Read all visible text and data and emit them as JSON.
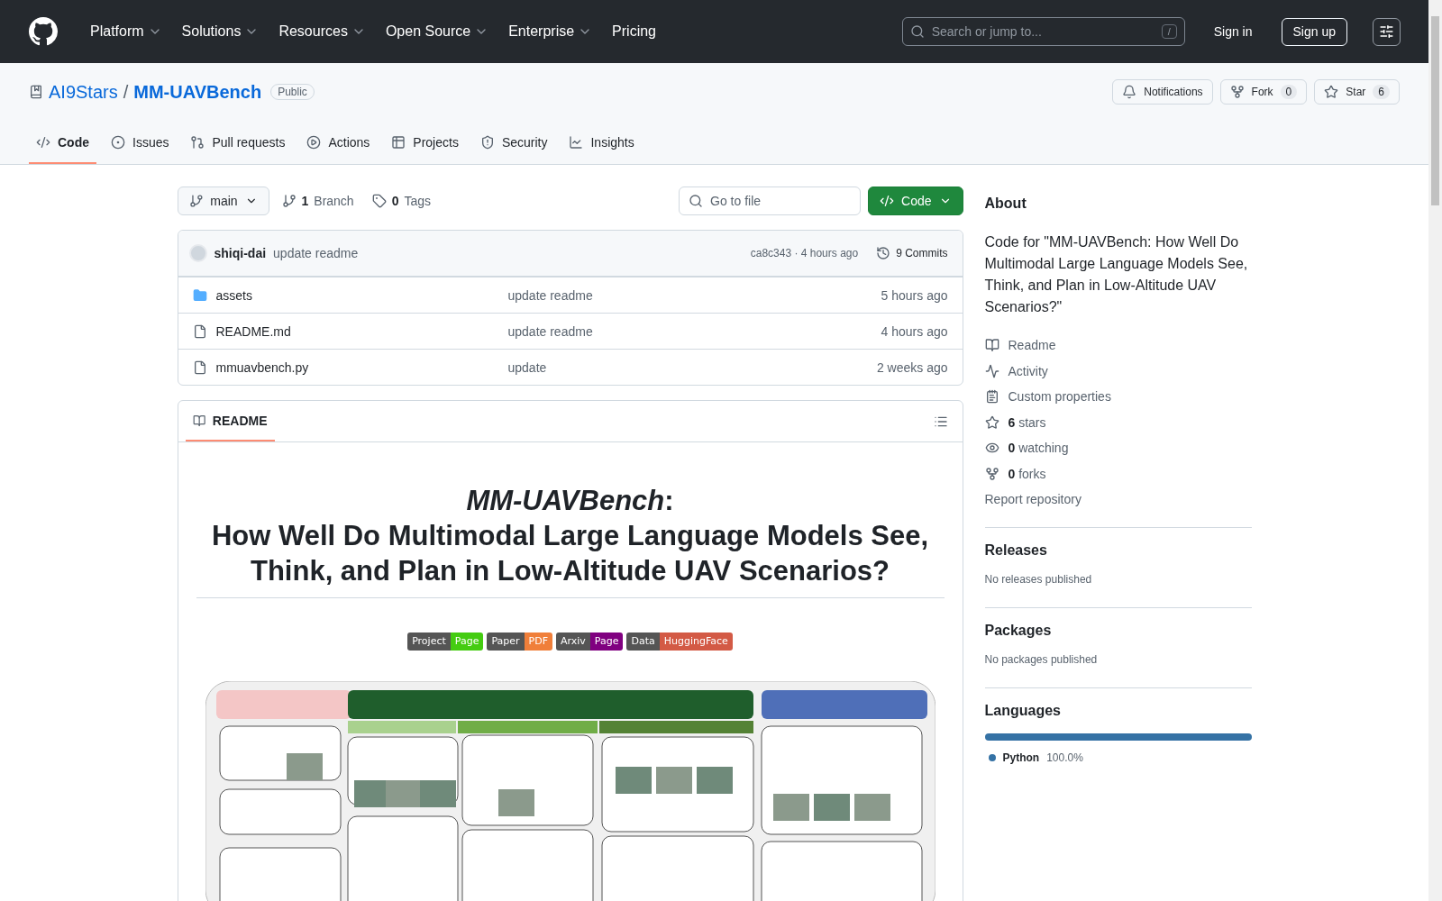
{
  "header": {
    "nav": [
      {
        "label": "Platform",
        "dropdown": true
      },
      {
        "label": "Solutions",
        "dropdown": true
      },
      {
        "label": "Resources",
        "dropdown": true
      },
      {
        "label": "Open Source",
        "dropdown": true
      },
      {
        "label": "Enterprise",
        "dropdown": true
      },
      {
        "label": "Pricing",
        "dropdown": false
      }
    ],
    "search": {
      "placeholder": "Search or jump to...",
      "shortcut": "/"
    },
    "sign_in": "Sign in",
    "sign_up": "Sign up"
  },
  "repo": {
    "owner": "AI9Stars",
    "separator": "/",
    "name": "MM-UAVBench",
    "visibility": "Public",
    "actions": [
      {
        "kind": "notifications",
        "label": "Notifications"
      },
      {
        "kind": "fork",
        "label": "Fork",
        "count": "0"
      },
      {
        "kind": "star",
        "label": "Star",
        "count": "6"
      }
    ],
    "tabs": [
      {
        "kind": "code",
        "label": "Code",
        "selected": true
      },
      {
        "kind": "issues",
        "label": "Issues",
        "selected": false
      },
      {
        "kind": "pulls",
        "label": "Pull requests",
        "selected": false
      },
      {
        "kind": "actions",
        "label": "Actions",
        "selected": false
      },
      {
        "kind": "projects",
        "label": "Projects",
        "selected": false
      },
      {
        "kind": "security",
        "label": "Security",
        "selected": false
      },
      {
        "kind": "insights",
        "label": "Insights",
        "selected": false
      }
    ]
  },
  "toolbar": {
    "branch": "main",
    "branches": {
      "count": "1",
      "label": "Branch"
    },
    "tags": {
      "count": "0",
      "label": "Tags"
    },
    "go_to_file": {
      "placeholder": "Go to file"
    },
    "code_button": "Code"
  },
  "commit": {
    "author": "shiqi-dai",
    "message": "update readme",
    "hash": "ca8c343 · 4 hours ago",
    "commits": "9 Commits"
  },
  "files": [
    {
      "kind": "folder",
      "name": "assets",
      "message": "update readme",
      "time": "5 hours ago"
    },
    {
      "kind": "file",
      "name": "README.md",
      "message": "update readme",
      "time": "4 hours ago"
    },
    {
      "kind": "file",
      "name": "mmuavbench.py",
      "message": "update",
      "time": "2 weeks ago"
    }
  ],
  "readme": {
    "tab": "README",
    "title_lines": [
      "*MM-UAVBench*:",
      "How Well Do Multimodal Large Language Models See,",
      "Think, and Plan in Low-Altitude UAV Scenarios?"
    ],
    "badges": [
      {
        "left": "Project",
        "right": "Page",
        "color": "#4c1"
      },
      {
        "left": "Paper",
        "right": "PDF",
        "color": "#f07f3a"
      },
      {
        "left": "Arxiv",
        "right": "Page",
        "color": "#800080"
      },
      {
        "left": "Data",
        "right": "HuggingFace",
        "color": "#d35a45"
      }
    ],
    "figure": {
      "kind": "picture"
    }
  },
  "about": {
    "heading": "About",
    "description": "Code for \"MM-UAVBench: How Well Do Multimodal Large Language Models See, Think, and Plan in Low-Altitude UAV Scenarios?\"",
    "links": [
      {
        "kind": "readme",
        "label": "Readme"
      },
      {
        "kind": "activity",
        "label": "Activity"
      },
      {
        "kind": "properties",
        "label": "Custom properties"
      },
      {
        "kind": "stars",
        "count": "6",
        "label": "stars"
      },
      {
        "kind": "watching",
        "count": "0",
        "label": "watching"
      },
      {
        "kind": "forks",
        "count": "0",
        "label": "forks"
      }
    ],
    "report": "Report repository"
  },
  "releases": {
    "heading": "Releases",
    "note": "No releases published"
  },
  "packages": {
    "heading": "Packages",
    "note": "No packages published"
  },
  "languages": {
    "heading": "Languages",
    "items": [
      {
        "name": "Python",
        "percent": "100.0%",
        "level": 1,
        "color": "#3572a5"
      }
    ]
  }
}
